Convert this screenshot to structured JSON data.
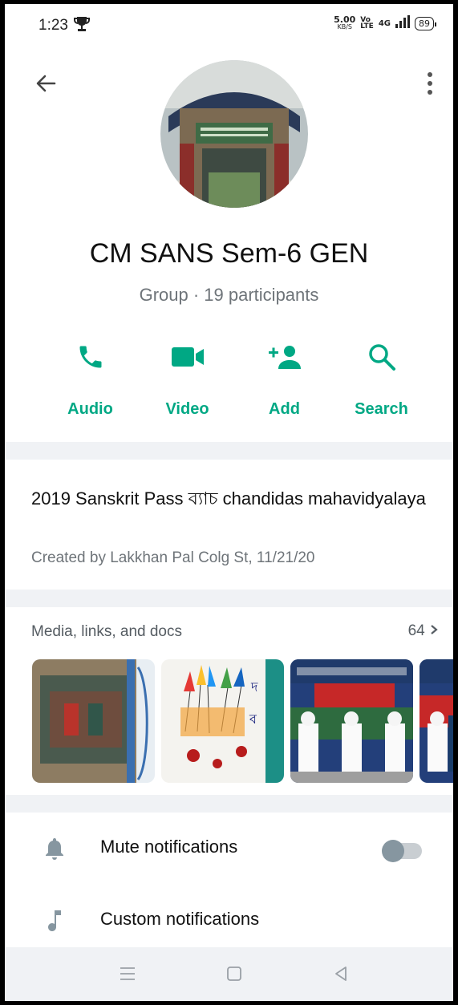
{
  "status_bar": {
    "time": "1:23",
    "speed": "5.00",
    "speed_unit": "KB/S",
    "volte_top": "Vo",
    "volte_bottom": "LTE",
    "network": "4G",
    "battery": "89"
  },
  "group": {
    "name": "CM SANS Sem-6 GEN",
    "subtitle": "Group · 19 participants",
    "description": "2019 Sanskrit Pass ব্যাচ chandidas mahavidyalaya",
    "created": "Created by Lakkhan Pal Colg St, 11/21/20"
  },
  "actions": [
    {
      "label": "Audio",
      "icon": "phone-icon"
    },
    {
      "label": "Video",
      "icon": "video-icon"
    },
    {
      "label": "Add",
      "icon": "add-person-icon"
    },
    {
      "label": "Search",
      "icon": "search-icon"
    }
  ],
  "media": {
    "title": "Media, links, and docs",
    "count": "64"
  },
  "settings": {
    "mute_label": "Mute notifications",
    "mute_on": false,
    "custom_label": "Custom notifications"
  },
  "colors": {
    "accent": "#00a884",
    "secondary_text": "#6e7479",
    "divider": "#f0f2f5"
  }
}
